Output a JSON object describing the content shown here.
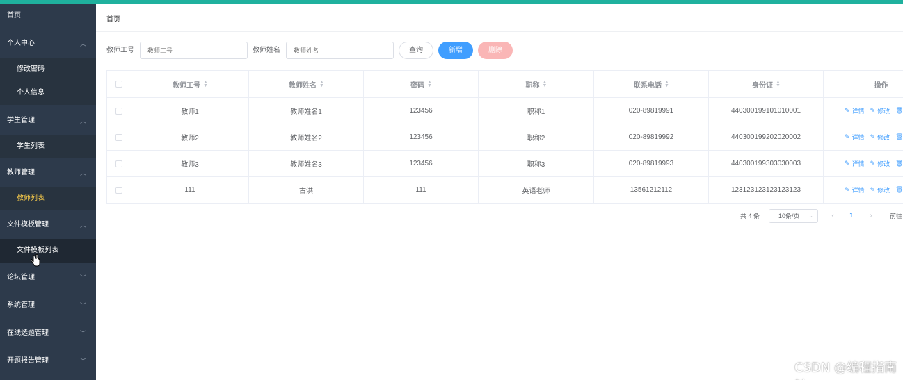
{
  "sidebar": {
    "items": [
      {
        "label": "首页",
        "type": "top",
        "chevron": ""
      },
      {
        "label": "个人中心",
        "type": "group",
        "chevron": "up"
      },
      {
        "label": "修改密码",
        "type": "sub"
      },
      {
        "label": "个人信息",
        "type": "sub"
      },
      {
        "label": "学生管理",
        "type": "group",
        "chevron": "up"
      },
      {
        "label": "学生列表",
        "type": "sub"
      },
      {
        "label": "教师管理",
        "type": "group",
        "chevron": "up"
      },
      {
        "label": "教师列表",
        "type": "sub",
        "active": true
      },
      {
        "label": "文件模板管理",
        "type": "group",
        "chevron": "up"
      },
      {
        "label": "文件模板列表",
        "type": "sub",
        "hover": true
      },
      {
        "label": "论坛管理",
        "type": "group",
        "chevron": "down"
      },
      {
        "label": "系统管理",
        "type": "group",
        "chevron": "down"
      },
      {
        "label": "在线选题管理",
        "type": "group",
        "chevron": "down"
      },
      {
        "label": "开题报告管理",
        "type": "group",
        "chevron": "down"
      }
    ]
  },
  "breadcrumb": "首页",
  "search": {
    "teacher_id_label": "教师工号",
    "teacher_id_placeholder": "教师工号",
    "teacher_name_label": "教师姓名",
    "teacher_name_placeholder": "教师姓名",
    "query_label": "查询",
    "add_label": "新增",
    "delete_label": "删除"
  },
  "table": {
    "columns": [
      "教师工号",
      "教师姓名",
      "密码",
      "职称",
      "联系电话",
      "身份证",
      "操作"
    ],
    "rows": [
      {
        "id": "教师1",
        "name": "教师姓名1",
        "password": "123456",
        "title": "职称1",
        "phone": "020-89819991",
        "idcard": "440300199101010001"
      },
      {
        "id": "教师2",
        "name": "教师姓名2",
        "password": "123456",
        "title": "职称2",
        "phone": "020-89819992",
        "idcard": "440300199202020002"
      },
      {
        "id": "教师3",
        "name": "教师姓名3",
        "password": "123456",
        "title": "职称3",
        "phone": "020-89819993",
        "idcard": "440300199303030003"
      },
      {
        "id": "111",
        "name": "古洪",
        "password": "111",
        "title": "英语老师",
        "phone": "13561212112",
        "idcard": "123123123123123123"
      }
    ],
    "ops": {
      "detail": "详情",
      "edit": "修改"
    }
  },
  "pagination": {
    "total": "共 4 条",
    "page_size": "10条/页",
    "current_page": "1",
    "goto": "前往"
  },
  "watermark": "CSDN @编程指南针",
  "colors": {
    "accent": "#409eff",
    "sidebar_bg": "#2d3a4b",
    "topbar": "#1fb19e",
    "active": "#ffd04b",
    "danger_light": "#fab6b6"
  }
}
